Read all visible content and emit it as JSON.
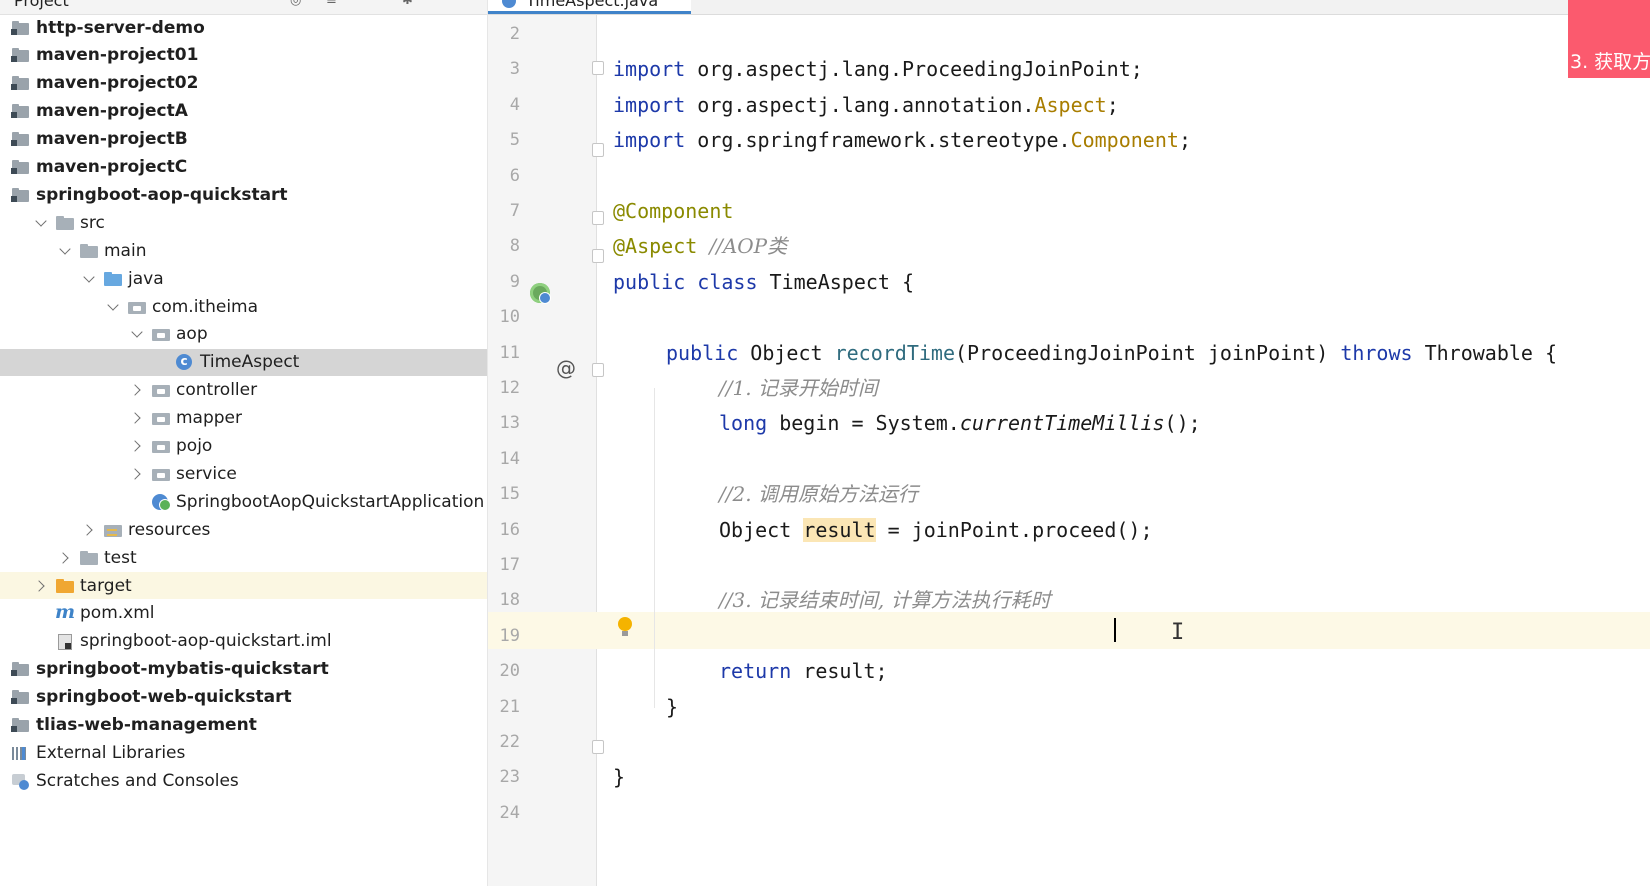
{
  "project_panel": {
    "title": "Project",
    "tree": [
      {
        "label": "http-server-demo",
        "icon": "module-icon",
        "depth": 0,
        "arrow": "none",
        "bold": true
      },
      {
        "label": "maven-project01",
        "icon": "module-icon",
        "depth": 0,
        "arrow": "none",
        "bold": true
      },
      {
        "label": "maven-project02",
        "icon": "module-icon",
        "depth": 0,
        "arrow": "none",
        "bold": true
      },
      {
        "label": "maven-projectA",
        "icon": "module-icon",
        "depth": 0,
        "arrow": "none",
        "bold": true
      },
      {
        "label": "maven-projectB",
        "icon": "module-icon",
        "depth": 0,
        "arrow": "none",
        "bold": true
      },
      {
        "label": "maven-projectC",
        "icon": "module-icon",
        "depth": 0,
        "arrow": "none",
        "bold": true
      },
      {
        "label": "springboot-aop-quickstart",
        "icon": "module-icon",
        "depth": 0,
        "arrow": "none",
        "bold": true
      },
      {
        "label": "src",
        "icon": "folder-icon",
        "depth": 1,
        "arrow": "open"
      },
      {
        "label": "main",
        "icon": "folder-icon",
        "depth": 2,
        "arrow": "open"
      },
      {
        "label": "java",
        "icon": "source-folder-icon",
        "depth": 3,
        "arrow": "open"
      },
      {
        "label": "com.itheima",
        "icon": "package-icon",
        "depth": 4,
        "arrow": "open"
      },
      {
        "label": "aop",
        "icon": "package-icon",
        "depth": 5,
        "arrow": "open"
      },
      {
        "label": "TimeAspect",
        "icon": "class-icon",
        "depth": 6,
        "arrow": "none",
        "selected": true
      },
      {
        "label": "controller",
        "icon": "package-icon",
        "depth": 5,
        "arrow": "closed"
      },
      {
        "label": "mapper",
        "icon": "package-icon",
        "depth": 5,
        "arrow": "closed"
      },
      {
        "label": "pojo",
        "icon": "package-icon",
        "depth": 5,
        "arrow": "closed"
      },
      {
        "label": "service",
        "icon": "package-icon",
        "depth": 5,
        "arrow": "closed"
      },
      {
        "label": "SpringbootAopQuickstartApplication",
        "icon": "spring-app-icon",
        "depth": 5,
        "arrow": "none"
      },
      {
        "label": "resources",
        "icon": "resources-folder-icon",
        "depth": 3,
        "arrow": "closed"
      },
      {
        "label": "test",
        "icon": "folder-icon",
        "depth": 2,
        "arrow": "closed"
      },
      {
        "label": "target",
        "icon": "excluded-folder-icon",
        "depth": 1,
        "arrow": "closed",
        "excluded": true
      },
      {
        "label": "pom.xml",
        "icon": "maven-icon",
        "depth": 1,
        "arrow": "none"
      },
      {
        "label": "springboot-aop-quickstart.iml",
        "icon": "iml-file-icon",
        "depth": 1,
        "arrow": "none"
      },
      {
        "label": "springboot-mybatis-quickstart",
        "icon": "module-icon",
        "depth": 0,
        "arrow": "none",
        "bold": true
      },
      {
        "label": "springboot-web-quickstart",
        "icon": "module-icon",
        "depth": 0,
        "arrow": "none",
        "bold": true
      },
      {
        "label": "tlias-web-management",
        "icon": "module-icon",
        "depth": 0,
        "arrow": "none",
        "bold": true
      },
      {
        "label": "External Libraries",
        "icon": "library-icon",
        "depth": 0,
        "arrow": "none"
      },
      {
        "label": "Scratches and Consoles",
        "icon": "scratches-icon",
        "depth": 0,
        "arrow": "none"
      }
    ]
  },
  "editor": {
    "tab_label": "TimeAspect.java",
    "current_line": 18,
    "lines": [
      {
        "no": "2",
        "tokens": []
      },
      {
        "no": "3",
        "indent": 0,
        "tokens": [
          {
            "t": "import",
            "c": "kw"
          },
          {
            "t": " org.aspectj.lang.ProceedingJoinPoint;"
          }
        ]
      },
      {
        "no": "4",
        "indent": 0,
        "tokens": [
          {
            "t": "import",
            "c": "kw"
          },
          {
            "t": " org.aspectj.lang.annotation."
          },
          {
            "t": "Aspect",
            "c": "cls-y"
          },
          {
            "t": ";"
          }
        ]
      },
      {
        "no": "5",
        "indent": 0,
        "tokens": [
          {
            "t": "import",
            "c": "kw"
          },
          {
            "t": " org.springframework.stereotype."
          },
          {
            "t": "Component",
            "c": "cls-y"
          },
          {
            "t": ";"
          }
        ]
      },
      {
        "no": "6",
        "tokens": []
      },
      {
        "no": "7",
        "indent": 0,
        "tokens": [
          {
            "t": "@Component",
            "c": "ann"
          }
        ]
      },
      {
        "no": "8",
        "indent": 0,
        "tokens": [
          {
            "t": "@Aspect",
            "c": "ann"
          },
          {
            "t": " "
          },
          {
            "t": "//AOP类",
            "c": "cmt"
          }
        ]
      },
      {
        "no": "9",
        "indent": 0,
        "tokens": [
          {
            "t": "public",
            "c": "kw"
          },
          {
            "t": " "
          },
          {
            "t": "class",
            "c": "kw"
          },
          {
            "t": " TimeAspect {"
          }
        ]
      },
      {
        "no": "10",
        "tokens": []
      },
      {
        "no": "11",
        "indent": 1,
        "tokens": [
          {
            "t": "public",
            "c": "kw"
          },
          {
            "t": " Object "
          },
          {
            "t": "recordTime",
            "c": "method"
          },
          {
            "t": "(ProceedingJoinPoint joinPoint) "
          },
          {
            "t": "throws",
            "c": "kw"
          },
          {
            "t": " Throwable {"
          }
        ]
      },
      {
        "no": "12",
        "indent": 2,
        "tokens": [
          {
            "t": "//1. 记录开始时间",
            "c": "cmt"
          }
        ]
      },
      {
        "no": "13",
        "indent": 2,
        "tokens": [
          {
            "t": "long",
            "c": "kw"
          },
          {
            "t": " begin = System."
          },
          {
            "t": "currentTimeMillis",
            "c": "italic"
          },
          {
            "t": "();"
          }
        ]
      },
      {
        "no": "14",
        "tokens": []
      },
      {
        "no": "15",
        "indent": 2,
        "tokens": [
          {
            "t": "//2. 调用原始方法运行",
            "c": "cmt"
          }
        ]
      },
      {
        "no": "16",
        "indent": 2,
        "tokens": [
          {
            "t": "Object "
          },
          {
            "t": "result",
            "c": "hl"
          },
          {
            "t": " = joinPoint.proceed();"
          }
        ]
      },
      {
        "no": "17",
        "tokens": []
      },
      {
        "no": "18",
        "indent": 2,
        "tokens": [
          {
            "t": "//3. 记录结束时间, 计算方法执行耗时",
            "c": "cmt"
          }
        ]
      },
      {
        "no": "19",
        "tokens": []
      },
      {
        "no": "20",
        "indent": 2,
        "tokens": [
          {
            "t": "return",
            "c": "kw"
          },
          {
            "t": " result;"
          }
        ]
      },
      {
        "no": "21",
        "indent": 1,
        "tokens": [
          {
            "t": "}"
          }
        ]
      },
      {
        "no": "22",
        "tokens": []
      },
      {
        "no": "23",
        "indent": 0,
        "tokens": [
          {
            "t": "}"
          }
        ]
      },
      {
        "no": "24",
        "tokens": []
      }
    ]
  },
  "overlay": {
    "step_label": "3. 获取方",
    "banner_color": "#fb5a6e"
  },
  "colors": {
    "keyword": "#1d39a9",
    "annotation": "#8a8a00",
    "comment": "#8c8c8c",
    "selection": "#d5d5d5",
    "current_line": "#fdf9e6",
    "tab_underline": "#4083c9"
  }
}
